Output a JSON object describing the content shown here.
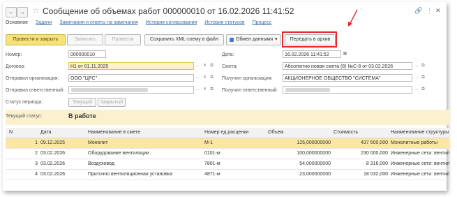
{
  "window": {
    "title": "Сообщение об объемах работ 000000010 от 16.02.2026 11:41:52",
    "back_glyph": "←",
    "forward_glyph": "→",
    "star_glyph": "☆",
    "link_glyph": "🔗",
    "more_glyph": "⋮",
    "close_glyph": "✕"
  },
  "tabs": [
    {
      "label": "Основное"
    },
    {
      "label": "Задачи"
    },
    {
      "label": "Замечания и ответы на замечания"
    },
    {
      "label": "История согласования"
    },
    {
      "label": "История статусов"
    },
    {
      "label": "Процесс"
    }
  ],
  "toolbar": {
    "post_close": "Провести и закрыть",
    "write": "Записать",
    "post": "Провести",
    "save_xml": "Сохранить XML-схему в файл",
    "exchange": "Обмен данными",
    "exchange_arrow": "▾",
    "archive": "Передать в архив"
  },
  "form": {
    "number_label": "Номер:",
    "number_value": "000000010",
    "date_label": "Дата:",
    "date_value": "16.02.2026 11:41:52",
    "contract_label": "Договор:",
    "contract_value": "Н1 от 01.11.2025",
    "estimate_label": "Смета:",
    "estimate_value": "Абсолютно новая смета (8) №С-8 от 03.02.2026",
    "sender_org_label": "Отправил организация:",
    "sender_org_value": "ООО \"ЦРС\"",
    "receiver_org_label": "Получил организация:",
    "receiver_org_value": "АКЦИОНЕРНОЕ ОБЩЕСТВО \"СИСТЕМА\"",
    "sender_resp_label": "Отправил ответственный:",
    "receiver_resp_label": "Получил ответственный:",
    "period_status_label": "Статус периода:",
    "period_current": "Текущий",
    "period_closed": "Закрытый",
    "ellipsis": "…",
    "clear": "✕",
    "open": "⧉",
    "dropdown": "▾",
    "calendar": "▦"
  },
  "status": {
    "label": "Текущий статус:",
    "value": "В работе"
  },
  "table": {
    "columns": [
      "N",
      "Дата",
      "Наименование в смете",
      "Номер ед расценки",
      "Объем",
      "Стоимость",
      "Наименование структуры"
    ],
    "rows": [
      {
        "n": "1",
        "date": "09.12.2025",
        "name": "Монолит",
        "code": "М-1",
        "volume": "125,000000000",
        "cost": "437 500,000",
        "struct": "Монолитные работы"
      },
      {
        "n": "2",
        "date": "03.02.2026",
        "name": "Оборудование вентиляции",
        "code": "0101-м",
        "volume": "100,000000000",
        "cost": "230 000,000",
        "struct": "Инженерные сети: вентил"
      },
      {
        "n": "3",
        "date": "03.02.2026",
        "name": "Воздуховод",
        "code": "7801-м",
        "volume": "54,000000000",
        "cost": "8 316,000",
        "struct": "Инженерные сети: вентил"
      },
      {
        "n": "4",
        "date": "03.02.2026",
        "name": "Приточно вентиляционная установка",
        "code": "4871-м",
        "volume": "23,000000000",
        "cost": "18 032,000",
        "struct": "Инженерные сети: вентил"
      }
    ]
  },
  "colors": {
    "primary": "#f7e27a",
    "highlight": "#e8262c",
    "selected_row": "#fbe6a3",
    "link": "#3d6ea8"
  }
}
